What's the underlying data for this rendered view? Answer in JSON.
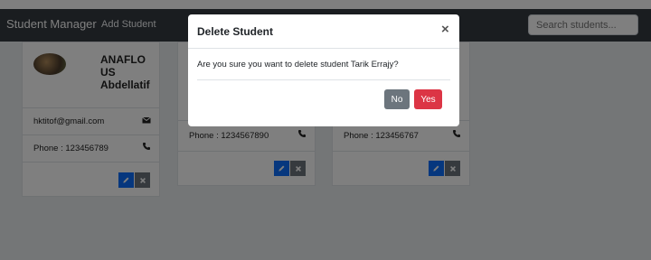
{
  "navbar": {
    "brand": "Student Manager",
    "link_add": "Add Student",
    "search_placeholder": "Search students..."
  },
  "cards": [
    {
      "name": "ANAFLO US Abdellatif",
      "email": "hktitof@gmail.com",
      "phone": "Phone : 123456789"
    },
    {
      "phone": "Phone : 1234567890"
    },
    {
      "phone": "Phone : 123456767"
    }
  ],
  "modal": {
    "title": "Delete Student",
    "close_symbol": "×",
    "message": "Are you sure you want to delete student Tarik Errajy?",
    "no_label": "No",
    "yes_label": "Yes"
  },
  "colors": {
    "navbar_bg": "#343a40",
    "edit_button": "#0d6efd",
    "delete_button": "#6c757d",
    "yes_button": "#dc3545",
    "no_button": "#6c757d"
  }
}
